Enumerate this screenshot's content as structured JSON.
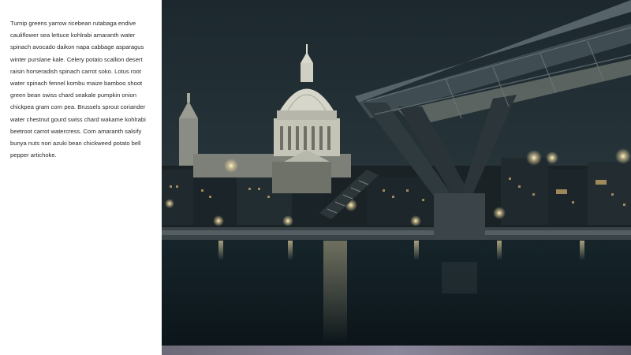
{
  "article": {
    "body": "Turnip greens yarrow ricebean rutabaga endive cauliflower sea lettuce kohlrabi amaranth water spinach avocado daikon napa cabbage asparagus winter purslane kale. Celery potato scallion desert raisin horseradish spinach carrot soko. Lotus root water spinach fennel kombu maize bamboo shoot green bean swiss chard seakale pumpkin onion chickpea gram corn pea. Brussels sprout coriander water chestnut gourd swiss chard wakame kohlrabi beetroot carrot watercress. Corn amaranth salsify bunya nuts nori azuki bean chickweed potato bell pepper artichoke."
  },
  "hero_image": {
    "subject": "night-city-photo",
    "colors": {
      "sky": "#1e2b31",
      "water": "#0f1a1f",
      "lights": "#f4dca0"
    }
  }
}
